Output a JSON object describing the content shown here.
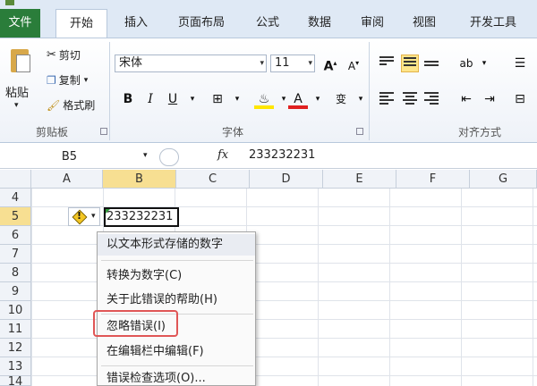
{
  "ribbon_tabs": [
    "文件",
    "开始",
    "插入",
    "页面布局",
    "公式",
    "数据",
    "审阅",
    "视图",
    "开发工具"
  ],
  "clipboard": {
    "paste": "粘贴",
    "cut": "剪切",
    "copy": "复制",
    "format_painter": "格式刷",
    "group_label": "剪贴板"
  },
  "font": {
    "name": "宋体",
    "size": "11",
    "group_label": "字体"
  },
  "alignment": {
    "group_label": "对齐方式"
  },
  "formula_bar": {
    "name_box": "B5",
    "fx": "fx",
    "value": "233232231"
  },
  "columns": [
    "A",
    "B",
    "C",
    "D",
    "E",
    "F",
    "G"
  ],
  "rows": [
    "4",
    "5",
    "6",
    "7",
    "8",
    "9",
    "10",
    "11",
    "12",
    "13",
    "14"
  ],
  "cell_b5": "233232231",
  "error_menu": {
    "header": "以文本形式存储的数字",
    "items": [
      "转换为数字(C)",
      "关于此错误的帮助(H)",
      "忽略错误(I)",
      "在编辑栏中编辑(F)",
      "错误检查选项(O)..."
    ]
  },
  "colors": {
    "file_tab": "#2a7d3a",
    "selection_header": "#f7df92",
    "highlight_box": "#e05656"
  }
}
